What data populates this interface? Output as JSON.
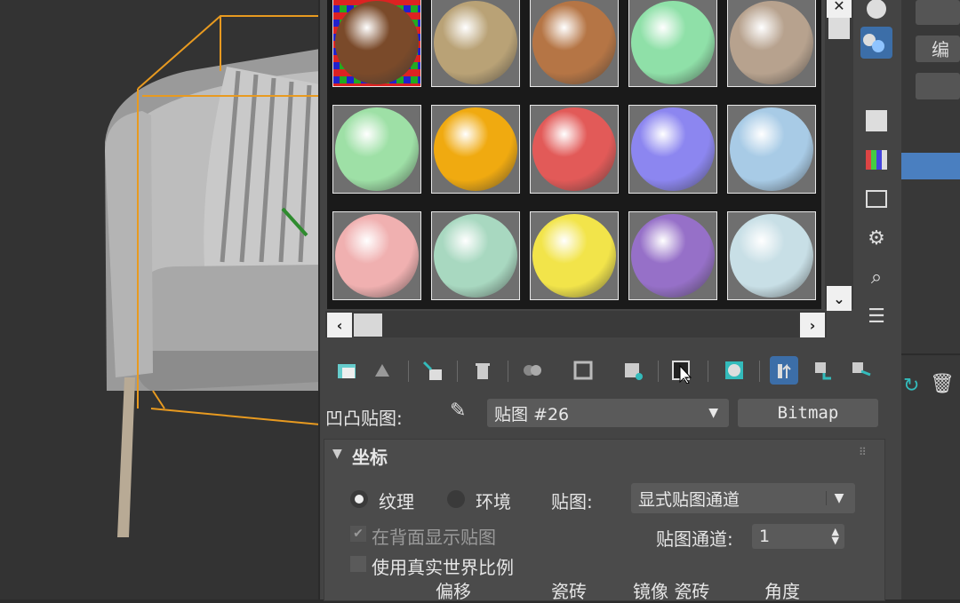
{
  "material_slots": [
    {
      "row": 0,
      "col": 0,
      "color": "#7a4a2a",
      "selected": true
    },
    {
      "row": 0,
      "col": 1,
      "color": "#b9a276"
    },
    {
      "row": 0,
      "col": 2,
      "color": "#b57545"
    },
    {
      "row": 0,
      "col": 3,
      "color": "#8fe0a8"
    },
    {
      "row": 0,
      "col": 4,
      "color": "#b7a28e"
    },
    {
      "row": 1,
      "col": 0,
      "color": "#9ee0a6"
    },
    {
      "row": 1,
      "col": 1,
      "color": "#f0aa10"
    },
    {
      "row": 1,
      "col": 2,
      "color": "#e25a58"
    },
    {
      "row": 1,
      "col": 3,
      "color": "#8c86f0"
    },
    {
      "row": 1,
      "col": 4,
      "color": "#a8cbe6"
    },
    {
      "row": 2,
      "col": 0,
      "color": "#f0b0b0"
    },
    {
      "row": 2,
      "col": 1,
      "color": "#a8d8c0"
    },
    {
      "row": 2,
      "col": 2,
      "color": "#f2e44a"
    },
    {
      "row": 2,
      "col": 3,
      "color": "#9670c8"
    },
    {
      "row": 2,
      "col": 4,
      "color": "#c8dfe6"
    }
  ],
  "map_row": {
    "label": "凹凸贴图:",
    "map_name": "贴图 #26",
    "map_type": "Bitmap"
  },
  "coords": {
    "title": "坐标",
    "texture_label": "纹理",
    "environ_label": "环境",
    "map_label": "贴图:",
    "map_mode": "显式贴图通道",
    "show_back_label": "在背面显示贴图",
    "channel_label": "贴图通道:",
    "channel_value": "1",
    "real_world_label": "使用真实世界比例",
    "col_offset": "偏移",
    "col_tiling": "瓷砖",
    "col_mirror_tile": "镜像 瓷砖",
    "col_angle": "角度"
  },
  "right_panel": {
    "edit_label": "编辑"
  },
  "colors": {
    "accent_blue": "#4a7fc0",
    "selection_orange": "#e89a20"
  }
}
